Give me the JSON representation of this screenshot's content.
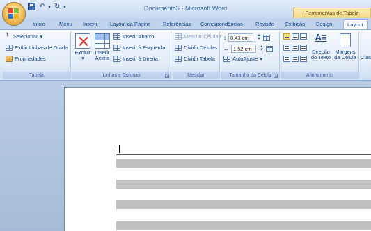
{
  "window": {
    "title": "Documento5 - Microsoft Word",
    "context_tab_title": "Ferramentas de Tabela"
  },
  "tabs": [
    {
      "label": "Início",
      "active": false
    },
    {
      "label": "Menu",
      "active": false
    },
    {
      "label": "Inserir",
      "active": false
    },
    {
      "label": "Layout da Página",
      "active": false
    },
    {
      "label": "Referências",
      "active": false
    },
    {
      "label": "Correspondências",
      "active": false
    },
    {
      "label": "Revisão",
      "active": false
    },
    {
      "label": "Exibição",
      "active": false
    },
    {
      "label": "Design",
      "active": false
    },
    {
      "label": "Layout",
      "active": true
    }
  ],
  "ribbon": {
    "tabela": {
      "label": "Tabela",
      "selecionar": "Selecionar",
      "exibir_linhas": "Exibir Linhas de Grade",
      "propriedades": "Propriedades"
    },
    "linhas_colunas": {
      "label": "Linhas e Colunas",
      "excluir": "Excluir",
      "inserir_acima_1": "Inserir",
      "inserir_acima_2": "Acima",
      "inserir_abaixo": "Inserir Abaixo",
      "inserir_esquerda": "Inserir à Esquerda",
      "inserir_direita": "Inserir à Direita"
    },
    "mesclar": {
      "label": "Mesclar",
      "mesclar_celulas": "Mesclar Células",
      "dividir_celulas": "Dividir Células",
      "dividir_tabela": "Dividir Tabela"
    },
    "tamanho": {
      "label": "Tamanho da Célula",
      "height_value": "0,43 cm",
      "width_value": "1,52 cm",
      "autoajuste": "AutoAjuste"
    },
    "alinhamento": {
      "label": "Alinhamento",
      "direcao_1": "Direção",
      "direcao_2": "do Texto",
      "margens_1": "Margens",
      "margens_2": "da Célula",
      "classificar": "Clas"
    }
  },
  "colors": {
    "ribbon_bg": "#e2ecf8",
    "context_tab": "#f2d580",
    "table_row": "#c0c0c0"
  }
}
